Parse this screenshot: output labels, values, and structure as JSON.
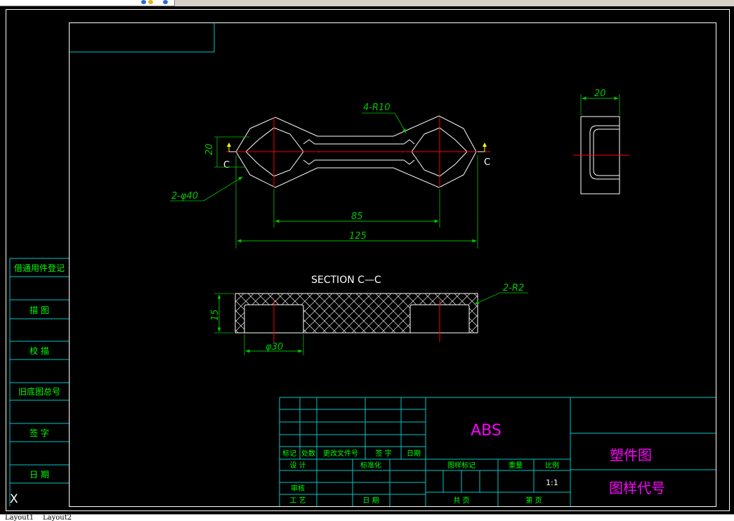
{
  "window": {
    "view": "CAD drawing model space"
  },
  "colors": {
    "background": "#000000",
    "outline": "#ffffff",
    "frame": "#ffffff",
    "table_line": "#00c8c8",
    "dimension": "#00c800",
    "center_line": "#ff0000",
    "hatch": "#ffffff",
    "table_text": "#00ff00",
    "title_text": "#ff00ff",
    "section_text": "#ffffff"
  },
  "drawing": {
    "dimensions": {
      "radius_label": "4-R10",
      "height_label": "20",
      "hole_label": "2-φ40",
      "center_distance": "85",
      "overall_length": "125",
      "side_width": "20",
      "section_radius": "2-R2",
      "section_thickness": "15",
      "section_hole": "φ30"
    },
    "section_marker": "C",
    "section_title": "SECTION  C—C"
  },
  "left_table": {
    "rows": [
      "借通用件登记",
      "描  图",
      "校  描",
      "旧底图总号",
      "签  字",
      "日  期"
    ]
  },
  "title_block": {
    "material": "ABS",
    "drawing_name": "塑件图",
    "drawing_code": "图样代号",
    "scale": "1:1",
    "labels": {
      "mark": "标记",
      "count": "处数",
      "change_doc": "更改文件号",
      "sign": "签  字",
      "date": "日期",
      "design": "设  计",
      "standard": "标准化",
      "review": "审核",
      "process": "工  艺",
      "approve_date": "日 期",
      "stage": "图样标记",
      "weight": "重量",
      "ratio": "比例",
      "sheets": "共   页",
      "sheet_no": "第   页"
    }
  },
  "ucs_icon": "X",
  "tabs": [
    "Layout1",
    "Layout2"
  ]
}
